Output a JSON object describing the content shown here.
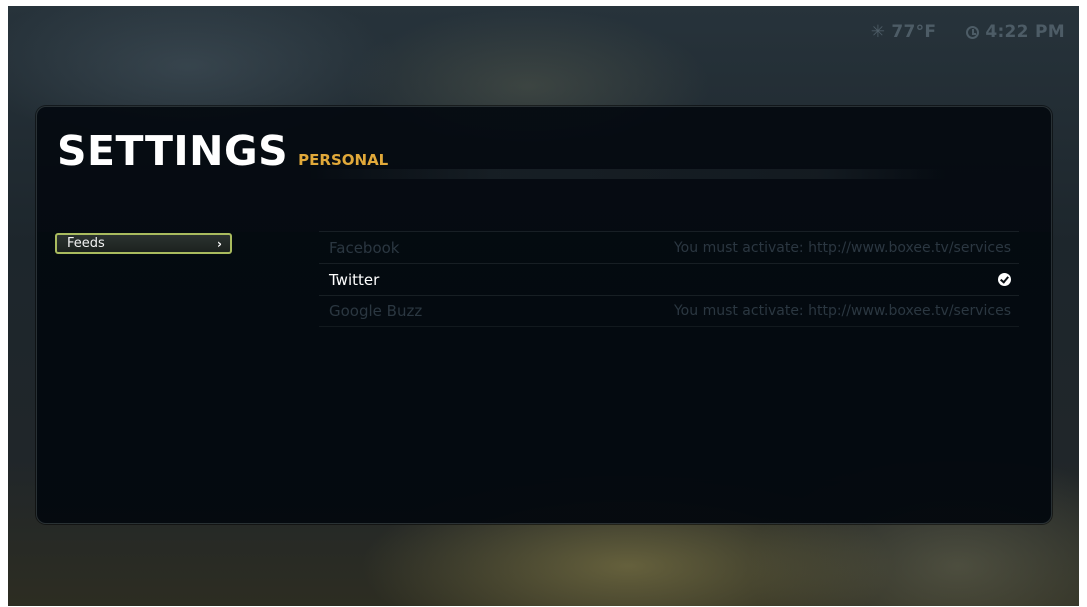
{
  "status_bar": {
    "weather_icon": "sun-icon",
    "temperature": "77°F",
    "clock_icon": "clock-icon",
    "time": "4:22 PM"
  },
  "settings": {
    "title": "SETTINGS",
    "subtitle": "PERSONAL"
  },
  "menu": {
    "items": [
      {
        "label": "Feeds",
        "selected": true,
        "icon": "chevron-right-icon"
      }
    ]
  },
  "services": [
    {
      "name": "Facebook",
      "status": "You must activate: http://www.boxee.tv/services",
      "enabled": false
    },
    {
      "name": "Twitter",
      "status": "",
      "status_icon": "check-circle-icon",
      "enabled": true
    },
    {
      "name": "Google Buzz",
      "status": "You must activate: http://www.boxee.tv/services",
      "enabled": false
    }
  ],
  "colors": {
    "accent": "#e1a93a",
    "selection_border": "#a9bb5e",
    "status_text": "#4d5c66",
    "disabled_text": "#2b3741"
  }
}
